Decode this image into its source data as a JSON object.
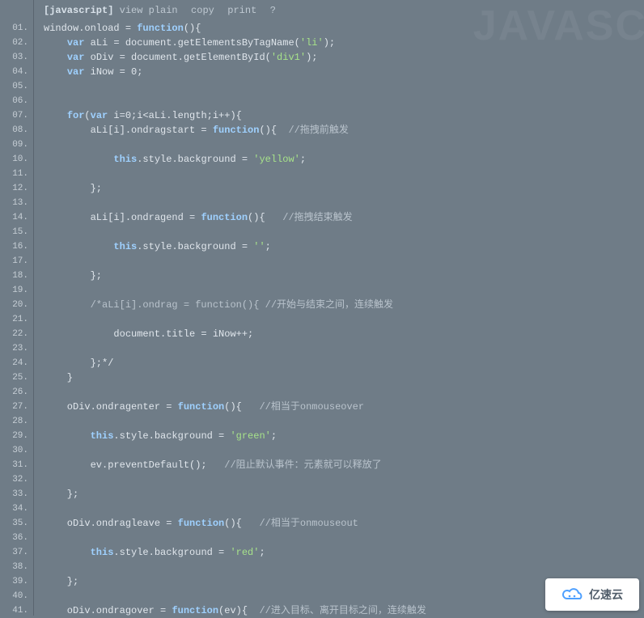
{
  "toolbar": {
    "tag": "[javascript]",
    "view": "view plain",
    "copy": "copy",
    "print": "print",
    "help": "?"
  },
  "watermark": "JAVASC",
  "badge": {
    "text": "亿速云"
  },
  "line_count": 41,
  "code": [
    [
      [
        "plain",
        "window.onload = "
      ],
      [
        "kw",
        "function"
      ],
      [
        "plain",
        "(){"
      ]
    ],
    [
      [
        "plain",
        "    "
      ],
      [
        "kw",
        "var"
      ],
      [
        "plain",
        " aLi = document.getElementsByTagName("
      ],
      [
        "str",
        "'li'"
      ],
      [
        "plain",
        ");"
      ]
    ],
    [
      [
        "plain",
        "    "
      ],
      [
        "kw",
        "var"
      ],
      [
        "plain",
        " oDiv = document.getElementById("
      ],
      [
        "str",
        "'div1'"
      ],
      [
        "plain",
        ");"
      ]
    ],
    [
      [
        "plain",
        "    "
      ],
      [
        "kw",
        "var"
      ],
      [
        "plain",
        " iNow = 0;"
      ]
    ],
    [],
    [],
    [
      [
        "plain",
        "    "
      ],
      [
        "kw",
        "for"
      ],
      [
        "plain",
        "("
      ],
      [
        "kw",
        "var"
      ],
      [
        "plain",
        " i=0;i<aLi.length;i++){"
      ]
    ],
    [
      [
        "plain",
        "        aLi[i].ondragstart = "
      ],
      [
        "kw",
        "function"
      ],
      [
        "plain",
        "(){  "
      ],
      [
        "com",
        "//拖拽前触发"
      ]
    ],
    [],
    [
      [
        "plain",
        "            "
      ],
      [
        "this",
        "this"
      ],
      [
        "plain",
        ".style.background = "
      ],
      [
        "str",
        "'yellow'"
      ],
      [
        "plain",
        ";"
      ]
    ],
    [],
    [
      [
        "plain",
        "        };"
      ]
    ],
    [],
    [
      [
        "plain",
        "        aLi[i].ondragend = "
      ],
      [
        "kw",
        "function"
      ],
      [
        "plain",
        "(){   "
      ],
      [
        "com",
        "//拖拽结束触发"
      ]
    ],
    [],
    [
      [
        "plain",
        "            "
      ],
      [
        "this",
        "this"
      ],
      [
        "plain",
        ".style.background = "
      ],
      [
        "str",
        "''"
      ],
      [
        "plain",
        ";"
      ]
    ],
    [],
    [
      [
        "plain",
        "        };"
      ]
    ],
    [],
    [
      [
        "plain",
        "        "
      ],
      [
        "com",
        "/*aLi[i].ondrag = function(){ //开始与结束之间，连续触发"
      ]
    ],
    [],
    [
      [
        "plain",
        "            document.title = iNow++;"
      ]
    ],
    [],
    [
      [
        "plain",
        "        };*/"
      ]
    ],
    [
      [
        "plain",
        "    }"
      ]
    ],
    [],
    [
      [
        "plain",
        "    oDiv.ondragenter = "
      ],
      [
        "kw",
        "function"
      ],
      [
        "plain",
        "(){   "
      ],
      [
        "com",
        "//相当于onmouseover"
      ]
    ],
    [],
    [
      [
        "plain",
        "        "
      ],
      [
        "this",
        "this"
      ],
      [
        "plain",
        ".style.background = "
      ],
      [
        "str",
        "'green'"
      ],
      [
        "plain",
        ";"
      ]
    ],
    [],
    [
      [
        "plain",
        "        ev.preventDefault();   "
      ],
      [
        "com",
        "//阻止默认事件：元素就可以释放了"
      ]
    ],
    [],
    [
      [
        "plain",
        "    };"
      ]
    ],
    [],
    [
      [
        "plain",
        "    oDiv.ondragleave = "
      ],
      [
        "kw",
        "function"
      ],
      [
        "plain",
        "(){   "
      ],
      [
        "com",
        "//相当于onmouseout"
      ]
    ],
    [],
    [
      [
        "plain",
        "        "
      ],
      [
        "this",
        "this"
      ],
      [
        "plain",
        ".style.background = "
      ],
      [
        "str",
        "'red'"
      ],
      [
        "plain",
        ";"
      ]
    ],
    [],
    [
      [
        "plain",
        "    };"
      ]
    ],
    [],
    [
      [
        "plain",
        "    oDiv.ondragover = "
      ],
      [
        "kw",
        "function"
      ],
      [
        "plain",
        "(ev){  "
      ],
      [
        "com",
        "//进入目标、离开目标之间，连续触发"
      ]
    ]
  ]
}
